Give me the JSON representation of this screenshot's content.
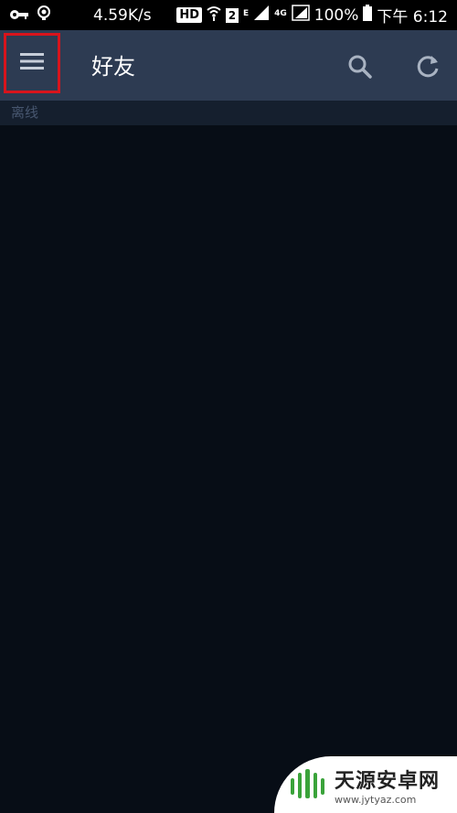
{
  "statusbar": {
    "speed": "4.59K/s",
    "hd": "HD",
    "sim_num": "2",
    "net_e": "E",
    "net_4g": "4G",
    "battery": "100%",
    "time": "下午 6:12"
  },
  "appbar": {
    "title": "好友"
  },
  "section": {
    "label": "离线"
  },
  "watermark": {
    "name": "天源安卓网",
    "url": "www.jytyaz.com"
  },
  "colors": {
    "appbar": "#2d3b52",
    "background": "#070d16",
    "highlight": "#d8141c"
  }
}
